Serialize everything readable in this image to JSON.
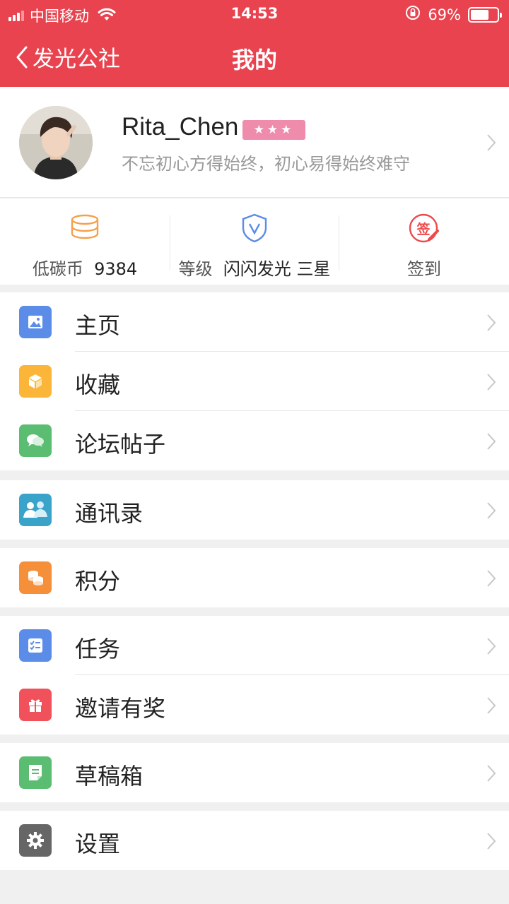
{
  "status_bar": {
    "carrier": "中国移动",
    "time": "14:53",
    "battery": "69%",
    "battery_level": 0.69
  },
  "nav": {
    "back_label": "发光公社",
    "title": "我的"
  },
  "profile": {
    "name": "Rita_Chen",
    "stars": "★★★",
    "signature": "不忘初心方得始终，初心易得始终难守"
  },
  "stats": {
    "coins_label": "低碳币",
    "coins_value": "9384",
    "level_label": "等级",
    "level_value": "闪闪发光 三星",
    "checkin_label": "签到",
    "checkin_badge": "签"
  },
  "menu": {
    "home": "主页",
    "favorites": "收藏",
    "forum_posts": "论坛帖子",
    "contacts": "通讯录",
    "points": "积分",
    "tasks": "任务",
    "invite": "邀请有奖",
    "drafts": "草稿箱",
    "settings": "设置"
  },
  "colors": {
    "header": "#e8434e",
    "home_icon": "#5b8ce8",
    "favorites_icon": "#fbb63a",
    "forum_icon": "#5bbd72",
    "contacts_icon": "#3aa3c9",
    "points_icon": "#f58f3a",
    "tasks_icon": "#5b8ce8",
    "invite_icon": "#f0515a",
    "drafts_icon": "#5bbd72",
    "settings_icon": "#666666"
  }
}
